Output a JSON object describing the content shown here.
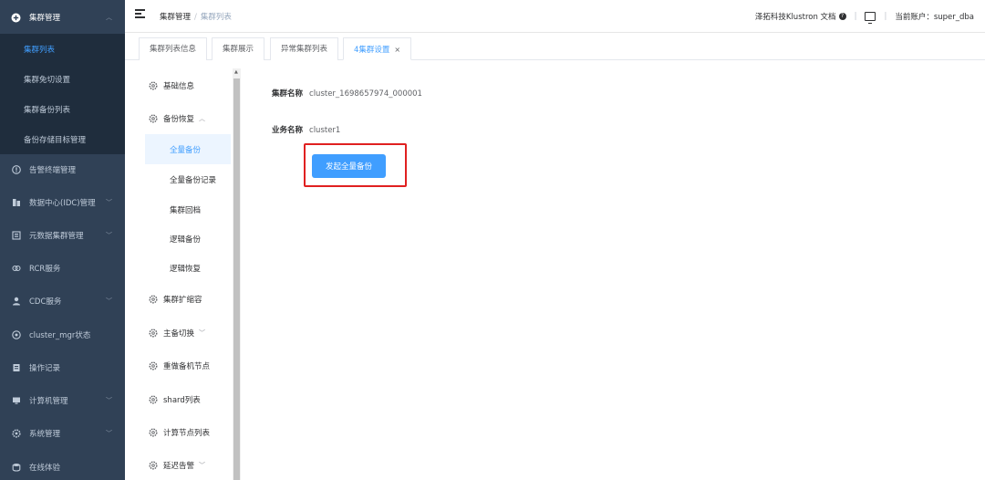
{
  "sidebar": {
    "group_head": {
      "label": "集群管理",
      "icon": "plus-circle-icon"
    },
    "subitems": [
      {
        "label": "集群列表",
        "active": true
      },
      {
        "label": "集群免切设置"
      },
      {
        "label": "集群备份列表"
      },
      {
        "label": "备份存储目标管理"
      }
    ],
    "items": [
      {
        "label": "告警终端管理",
        "icon": "alert-icon"
      },
      {
        "label": "数据中心(IDC)管理",
        "icon": "building-icon"
      },
      {
        "label": "元数据集群管理",
        "icon": "database-icon"
      },
      {
        "label": "RCR服务",
        "icon": "link-icon"
      },
      {
        "label": "CDC服务",
        "icon": "user-icon"
      },
      {
        "label": "cluster_mgr状态",
        "icon": "status-icon"
      },
      {
        "label": "操作记录",
        "icon": "record-icon"
      },
      {
        "label": "计算机管理",
        "icon": "monitor-icon"
      },
      {
        "label": "系统管理",
        "icon": "gear-icon"
      },
      {
        "label": "在线体验",
        "icon": "db-icon"
      }
    ]
  },
  "header": {
    "breadcrumb": [
      "集群管理",
      "集群列表"
    ],
    "doc_link": "泽拓科技Klustron 文档",
    "account": "当前账户：super_dba"
  },
  "tabs": [
    {
      "label": "集群列表信息"
    },
    {
      "label": "集群展示"
    },
    {
      "label": "异常集群列表"
    },
    {
      "label": "4集群设置",
      "active": true
    }
  ],
  "submenu": {
    "items": [
      {
        "label": "基础信息"
      },
      {
        "label": "备份恢复"
      },
      {
        "label": "集群扩缩容"
      },
      {
        "label": "主备切换"
      },
      {
        "label": "重做备机节点"
      },
      {
        "label": "shard列表"
      },
      {
        "label": "计算节点列表"
      },
      {
        "label": "延迟告警"
      }
    ],
    "children": [
      {
        "label": "全量备份",
        "active": true
      },
      {
        "label": "全量备份记录"
      },
      {
        "label": "集群回档"
      },
      {
        "label": "逻辑备份"
      },
      {
        "label": "逻辑恢复"
      }
    ]
  },
  "content": {
    "cluster_name_label": "集群名称",
    "cluster_name_value": "cluster_1698657974_000001",
    "business_name_label": "业务名称",
    "business_name_value": "cluster1",
    "action_button": "发起全量备份"
  },
  "colors": {
    "sidebar_bg": "#304156",
    "primary": "#409eff",
    "highlight": "#e02020"
  }
}
